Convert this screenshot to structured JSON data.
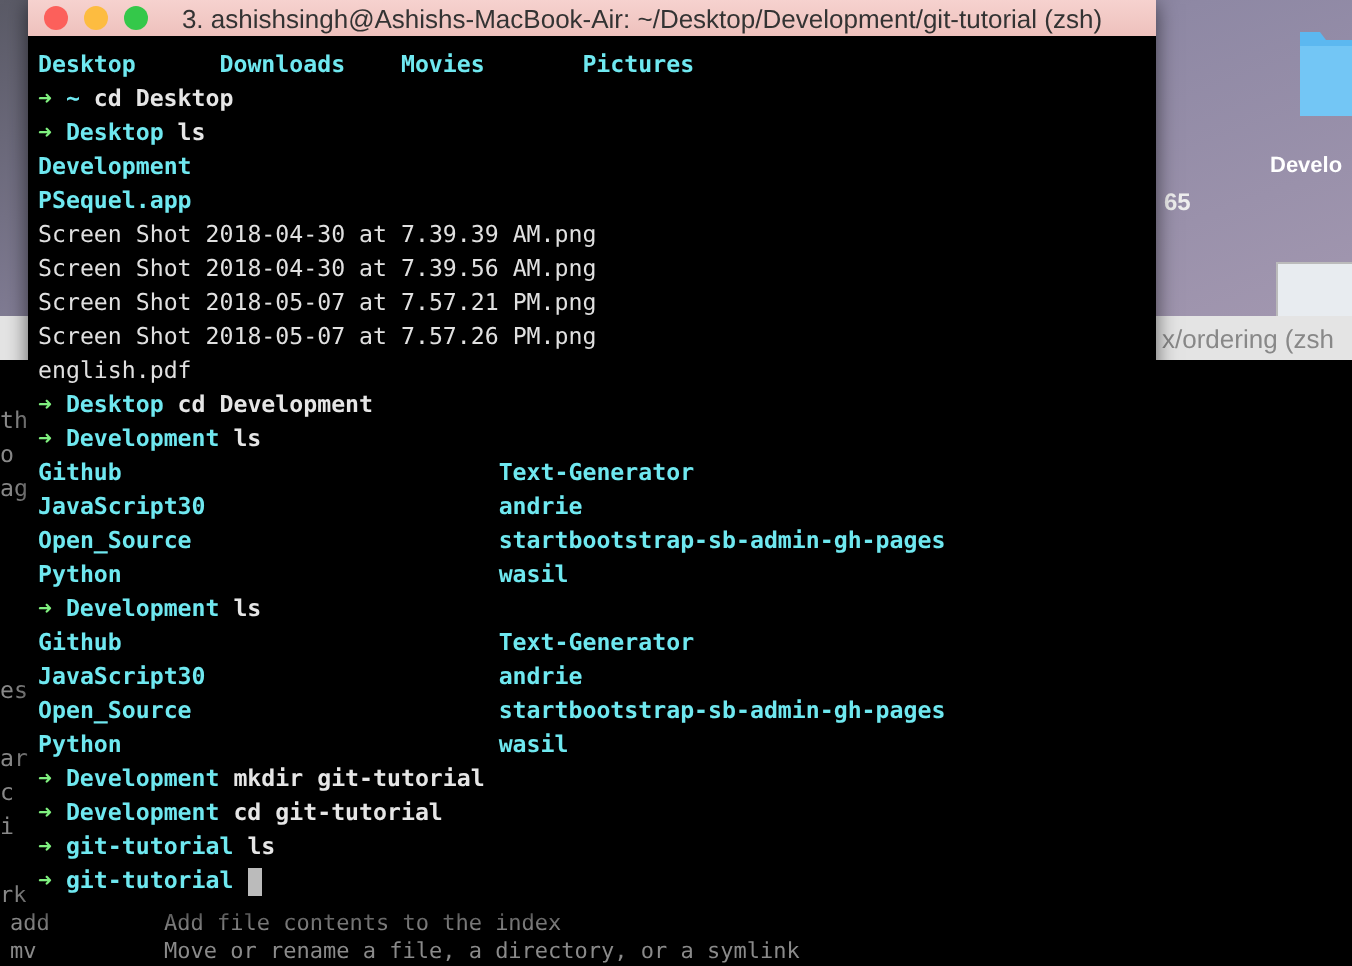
{
  "desktop": {
    "folder_label": "Develo",
    "stray_text": "65"
  },
  "back_window": {
    "title": "x/ordering (zsh",
    "fragment_groups": [
      [
        "th",
        "o",
        "ag"
      ],
      [
        "es"
      ],
      [
        "ar",
        "c",
        "i"
      ]
    ],
    "partial_line": "rk",
    "commands": [
      {
        "name": "add",
        "description": "Add file contents to the index"
      },
      {
        "name": "mv",
        "description": "Move or rename a file, a directory, or a symlink"
      }
    ]
  },
  "window": {
    "title": "3. ashishsingh@Ashishs-MacBook-Air: ~/Desktop/Development/git-tutorial (zsh)"
  },
  "lines": [
    {
      "kind": "listing",
      "entries": [
        {
          "text": "Desktop",
          "kind": "dir"
        },
        {
          "text": "Downloads",
          "kind": "dir"
        },
        {
          "text": "Movies",
          "kind": "dir"
        },
        {
          "text": "Pictures",
          "kind": "dir"
        }
      ]
    },
    {
      "kind": "prompt",
      "arrow": "➜",
      "dir": "~",
      "command": "cd Desktop",
      "cursor": false
    },
    {
      "kind": "prompt",
      "arrow": "➜",
      "dir": "Desktop",
      "command": "ls",
      "cursor": false
    },
    {
      "kind": "listing",
      "entries": [
        {
          "text": "Development",
          "kind": "dir"
        }
      ]
    },
    {
      "kind": "listing",
      "entries": [
        {
          "text": "PSequel.app",
          "kind": "dir"
        }
      ]
    },
    {
      "kind": "listing",
      "entries": [
        {
          "text": "Screen Shot 2018-04-30 at 7.39.39 AM.png",
          "kind": "file"
        }
      ]
    },
    {
      "kind": "listing",
      "entries": [
        {
          "text": "Screen Shot 2018-04-30 at 7.39.56 AM.png",
          "kind": "file"
        }
      ]
    },
    {
      "kind": "listing",
      "entries": [
        {
          "text": "Screen Shot 2018-05-07 at 7.57.21 PM.png",
          "kind": "file"
        }
      ]
    },
    {
      "kind": "listing",
      "entries": [
        {
          "text": "Screen Shot 2018-05-07 at 7.57.26 PM.png",
          "kind": "file"
        }
      ]
    },
    {
      "kind": "listing",
      "entries": [
        {
          "text": "english.pdf",
          "kind": "file"
        }
      ]
    },
    {
      "kind": "prompt",
      "arrow": "➜",
      "dir": "Desktop",
      "command": "cd Development",
      "cursor": false
    },
    {
      "kind": "prompt",
      "arrow": "➜",
      "dir": "Development",
      "command": "ls",
      "cursor": false
    },
    {
      "kind": "listing",
      "entries": [
        {
          "text": "Github",
          "kind": "dir"
        },
        {
          "text": "Text-Generator",
          "kind": "dir"
        }
      ]
    },
    {
      "kind": "listing",
      "entries": [
        {
          "text": "JavaScript30",
          "kind": "dir"
        },
        {
          "text": "andrie",
          "kind": "dir"
        }
      ]
    },
    {
      "kind": "listing",
      "entries": [
        {
          "text": "Open_Source",
          "kind": "dir"
        },
        {
          "text": "startbootstrap-sb-admin-gh-pages",
          "kind": "dir"
        }
      ]
    },
    {
      "kind": "listing",
      "entries": [
        {
          "text": "Python",
          "kind": "dir"
        },
        {
          "text": "wasil",
          "kind": "dir"
        }
      ]
    },
    {
      "kind": "prompt",
      "arrow": "➜",
      "dir": "Development",
      "command": "ls",
      "cursor": false
    },
    {
      "kind": "listing",
      "entries": [
        {
          "text": "Github",
          "kind": "dir"
        },
        {
          "text": "Text-Generator",
          "kind": "dir"
        }
      ]
    },
    {
      "kind": "listing",
      "entries": [
        {
          "text": "JavaScript30",
          "kind": "dir"
        },
        {
          "text": "andrie",
          "kind": "dir"
        }
      ]
    },
    {
      "kind": "listing",
      "entries": [
        {
          "text": "Open_Source",
          "kind": "dir"
        },
        {
          "text": "startbootstrap-sb-admin-gh-pages",
          "kind": "dir"
        }
      ]
    },
    {
      "kind": "listing",
      "entries": [
        {
          "text": "Python",
          "kind": "dir"
        },
        {
          "text": "wasil",
          "kind": "dir"
        }
      ]
    },
    {
      "kind": "prompt",
      "arrow": "➜",
      "dir": "Development",
      "command": "mkdir git-tutorial",
      "cursor": false
    },
    {
      "kind": "prompt",
      "arrow": "➜",
      "dir": "Development",
      "command": "cd git-tutorial",
      "cursor": false
    },
    {
      "kind": "prompt",
      "arrow": "➜",
      "dir": "git-tutorial",
      "command": "ls",
      "cursor": false
    },
    {
      "kind": "prompt",
      "arrow": "➜",
      "dir": "git-tutorial",
      "cursor": true
    }
  ]
}
